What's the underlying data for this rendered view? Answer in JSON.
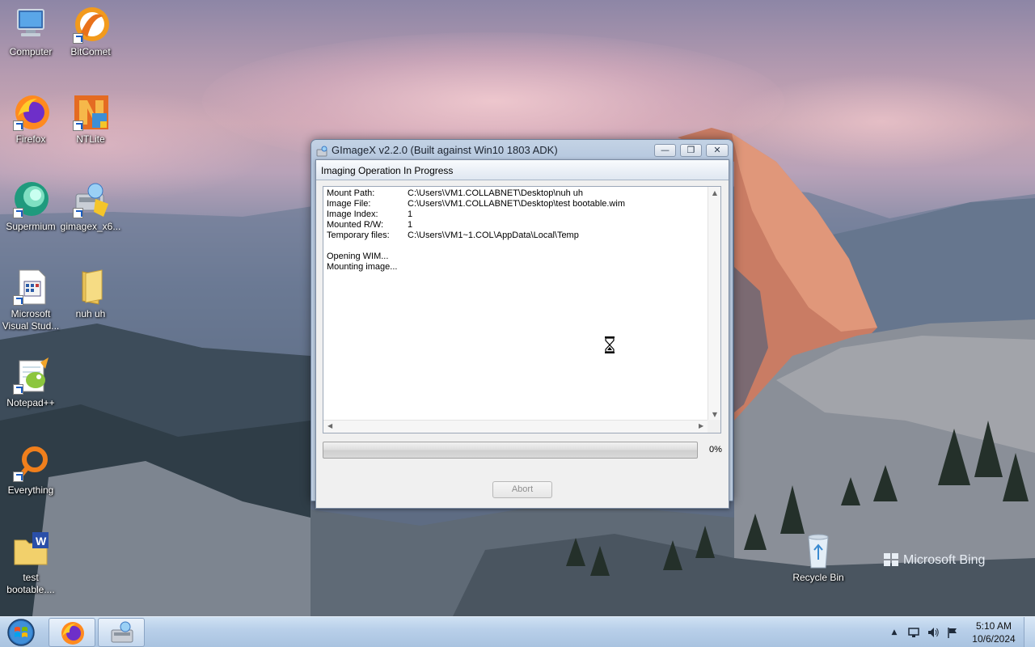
{
  "desktop": {
    "icons": [
      {
        "label": "Computer"
      },
      {
        "label": "BitComet"
      },
      {
        "label": "Firefox"
      },
      {
        "label": "NTLite"
      },
      {
        "label": "Supermium"
      },
      {
        "label": "gimagex_x6..."
      },
      {
        "label": "Microsoft Visual Stud..."
      },
      {
        "label": "nuh uh"
      },
      {
        "label": "Notepad++"
      },
      {
        "label": "Everything"
      },
      {
        "label": "test bootable...."
      },
      {
        "label": "Recycle Bin"
      }
    ],
    "watermark": "Microsoft Bing"
  },
  "window": {
    "title": "GImageX v2.2.0 (Built against Win10 1803 ADK)",
    "minimize_glyph": "—",
    "restore_glyph": "❐",
    "close_glyph": "✕"
  },
  "dialog": {
    "title": "Imaging Operation In Progress",
    "details": [
      {
        "key": "Mount Path:",
        "value": "C:\\Users\\VM1.COLLABNET\\Desktop\\nuh uh"
      },
      {
        "key": "Image File:",
        "value": "C:\\Users\\VM1.COLLABNET\\Desktop\\test bootable.wim"
      },
      {
        "key": "Image Index:",
        "value": "1"
      },
      {
        "key": "Mounted R/W:",
        "value": "1"
      },
      {
        "key": "Temporary files:",
        "value": "C:\\Users\\VM1~1.COL\\AppData\\Local\\Temp"
      }
    ],
    "log": [
      "Opening WIM...",
      "Mounting image..."
    ],
    "progress_percent": 0,
    "progress_label": "0%",
    "abort_label": "Abort"
  },
  "taskbar": {
    "time": "5:10 AM",
    "date": "10/6/2024",
    "tray_arrow": "▲"
  },
  "colors": {
    "accent": "#3b78c4",
    "dialog_bg": "#f0f0f0",
    "taskbar": "#b9d0ea"
  }
}
